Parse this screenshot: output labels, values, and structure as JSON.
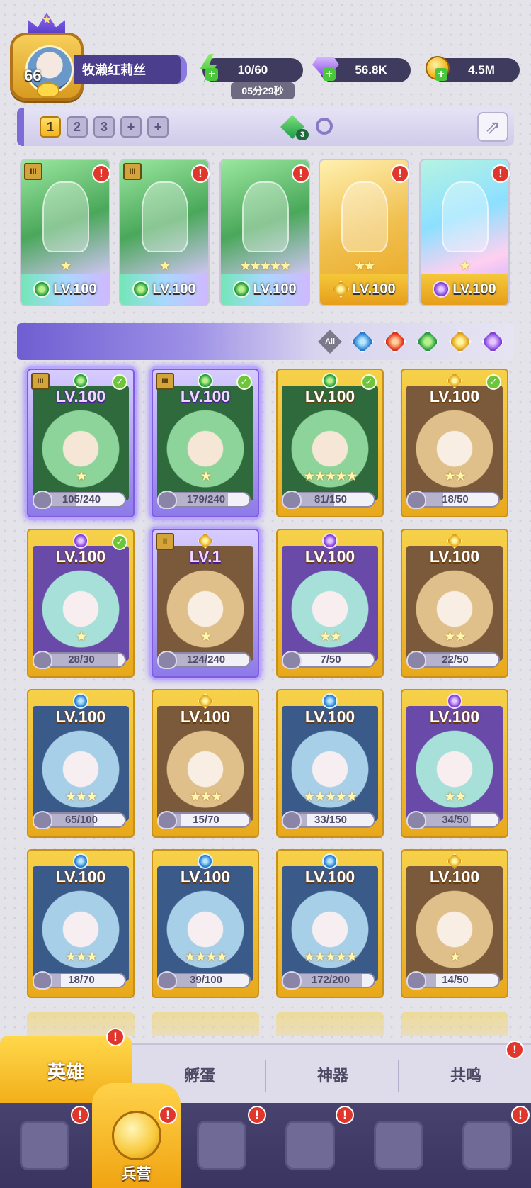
{
  "player": {
    "level": "66",
    "name": "牧濑红莉丝",
    "avatar_icon": "player-avatar"
  },
  "resources": {
    "energy": "10/60",
    "energy_timer": "05分29秒",
    "gems": "56.8K",
    "gold": "4.5M"
  },
  "team_bar": {
    "tabs": [
      "1",
      "2",
      "3",
      "+",
      "+"
    ],
    "active_tab": "1",
    "gem_count": "3",
    "share_icon": "share-icon"
  },
  "team": [
    {
      "level": "LV.100",
      "element": "nature",
      "stars": "★",
      "rank": "III",
      "alert": "!"
    },
    {
      "level": "LV.100",
      "element": "nature",
      "stars": "★",
      "rank": "III",
      "alert": "!"
    },
    {
      "level": "LV.100",
      "element": "nature",
      "stars": "★★★★★",
      "rank": "",
      "alert": "!"
    },
    {
      "level": "LV.100",
      "element": "light",
      "stars": "★★",
      "rank": "",
      "alert": "!"
    },
    {
      "level": "LV.100",
      "element": "dark",
      "stars": "★",
      "rank": "",
      "alert": "!"
    }
  ],
  "filters": {
    "all_label": "All",
    "elements": [
      "water",
      "fire",
      "nature",
      "light",
      "dark"
    ]
  },
  "heroes": [
    {
      "level": "LV.100",
      "element": "nature",
      "shards": "105/240",
      "progress": 0.44,
      "stars": "★",
      "checked": true,
      "rank": "III",
      "selected": true
    },
    {
      "level": "LV.100",
      "element": "nature",
      "shards": "179/240",
      "progress": 0.75,
      "stars": "★",
      "checked": true,
      "rank": "III",
      "selected": true
    },
    {
      "level": "LV.100",
      "element": "nature",
      "shards": "81/150",
      "progress": 0.54,
      "stars": "★★★★★",
      "checked": true,
      "rank": "",
      "selected": false
    },
    {
      "level": "LV.100",
      "element": "light",
      "shards": "18/50",
      "progress": 0.36,
      "stars": "★★",
      "checked": true,
      "rank": "",
      "selected": false
    },
    {
      "level": "LV.100",
      "element": "dark",
      "shards": "28/30",
      "progress": 0.93,
      "stars": "★",
      "checked": true,
      "rank": "",
      "selected": false
    },
    {
      "level": "LV.1",
      "element": "light",
      "shards": "124/240",
      "progress": 0.52,
      "stars": "★",
      "checked": false,
      "rank": "II",
      "selected": true
    },
    {
      "level": "LV.100",
      "element": "dark",
      "shards": "7/50",
      "progress": 0.14,
      "stars": "★★",
      "checked": false,
      "rank": "",
      "selected": false
    },
    {
      "level": "LV.100",
      "element": "light",
      "shards": "22/50",
      "progress": 0.44,
      "stars": "★★",
      "checked": false,
      "rank": "",
      "selected": false
    },
    {
      "level": "LV.100",
      "element": "water",
      "shards": "65/100",
      "progress": 0.65,
      "stars": "★★★",
      "checked": false,
      "rank": "",
      "selected": false
    },
    {
      "level": "LV.100",
      "element": "light",
      "shards": "15/70",
      "progress": 0.21,
      "stars": "★★★",
      "checked": false,
      "rank": "",
      "selected": false
    },
    {
      "level": "LV.100",
      "element": "water",
      "shards": "33/150",
      "progress": 0.22,
      "stars": "★★★★★",
      "checked": false,
      "rank": "",
      "selected": false
    },
    {
      "level": "LV.100",
      "element": "dark",
      "shards": "34/50",
      "progress": 0.68,
      "stars": "★★",
      "checked": false,
      "rank": "",
      "selected": false
    },
    {
      "level": "LV.100",
      "element": "water",
      "shards": "18/70",
      "progress": 0.26,
      "stars": "★★★",
      "checked": false,
      "rank": "",
      "selected": false
    },
    {
      "level": "LV.100",
      "element": "water",
      "shards": "39/100",
      "progress": 0.39,
      "stars": "★★★★",
      "checked": false,
      "rank": "",
      "selected": false
    },
    {
      "level": "LV.100",
      "element": "water",
      "shards": "172/200",
      "progress": 0.86,
      "stars": "★★★★★",
      "checked": false,
      "rank": "",
      "selected": false
    },
    {
      "level": "LV.100",
      "element": "light",
      "shards": "14/50",
      "progress": 0.28,
      "stars": "★",
      "checked": false,
      "rank": "",
      "selected": false
    }
  ],
  "sub_tabs": [
    "英雄",
    "孵蛋",
    "神器",
    "共鸣"
  ],
  "nav": {
    "items": [
      "cards-icon",
      "barracks-icon",
      "book-icon",
      "castle-icon",
      "mushroom-icon",
      "shield-icon"
    ],
    "active_label": "兵营"
  },
  "colors": {
    "accent": "#7d6cd8",
    "gold": "#f2b51c",
    "alert": "#e0362c"
  }
}
